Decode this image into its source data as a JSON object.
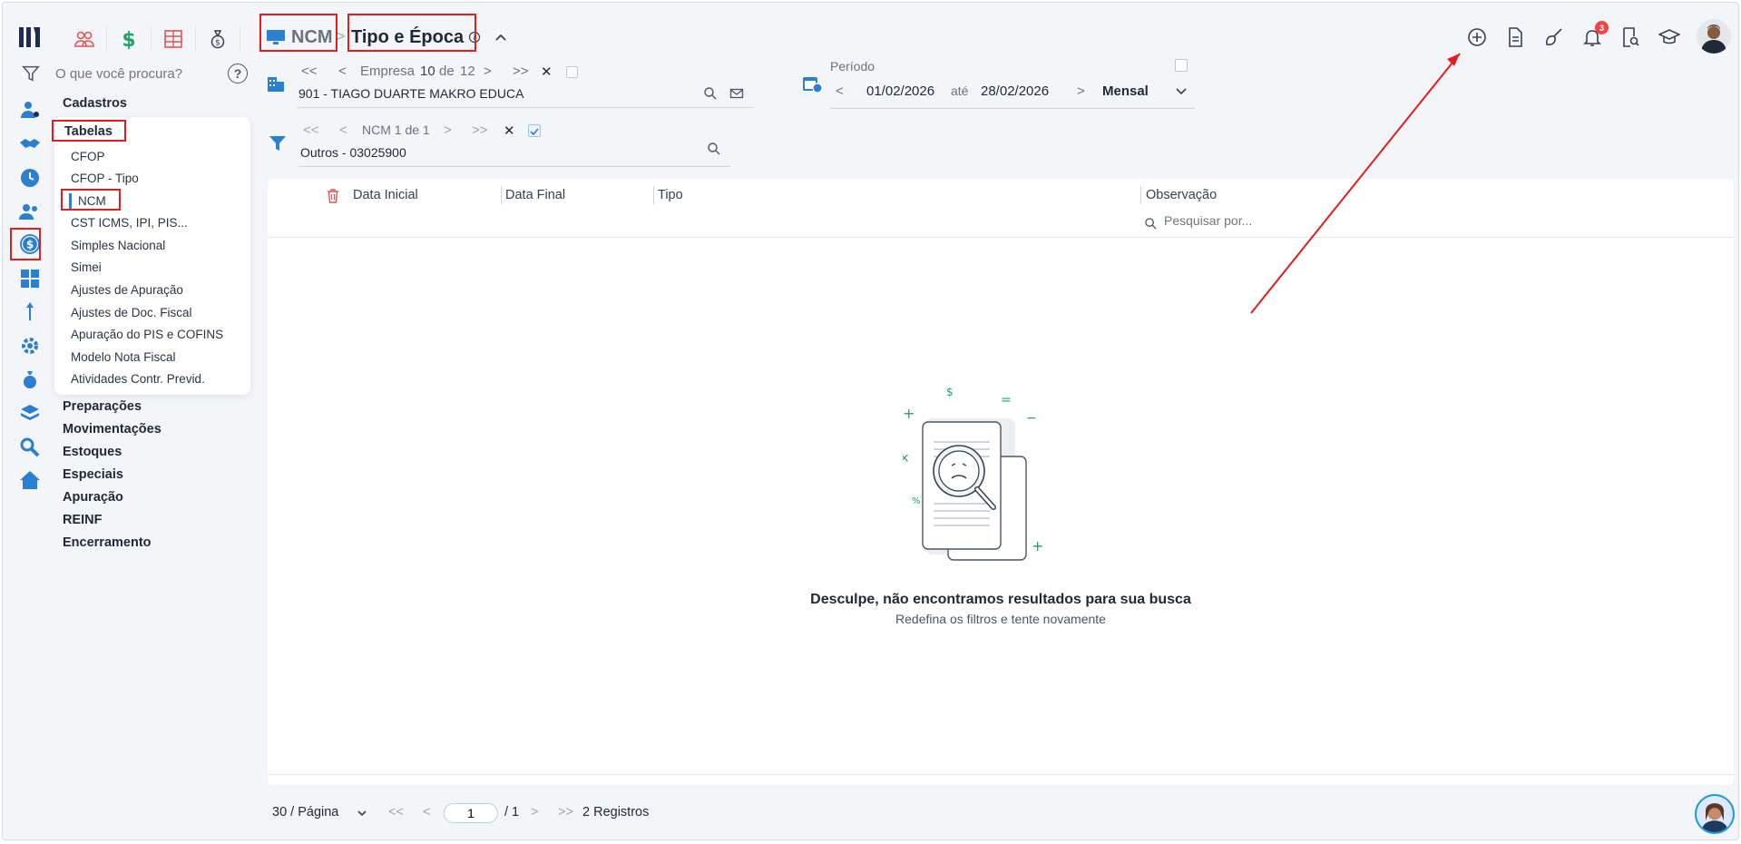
{
  "search": {
    "placeholder": "O que você procura?"
  },
  "help": {
    "label": "?"
  },
  "menu": {
    "categories_top": [
      "Cadastros"
    ],
    "tabelas_title": "Tabelas",
    "tabelas_items": [
      "CFOP",
      "CFOP - Tipo",
      "NCM",
      "CST ICMS, IPI, PIS...",
      "Simples Nacional",
      "Simei",
      "Ajustes de Apuração",
      "Ajustes de Doc. Fiscal",
      "Apuração do PIS e COFINS",
      "Modelo Nota Fiscal",
      "Atividades Contr. Previd."
    ],
    "categories_bottom": [
      "Preparações",
      "Movimentações",
      "Estoques",
      "Especiais",
      "Apuração",
      "REINF",
      "Encerramento"
    ]
  },
  "breadcrumb": {
    "module": "NCM",
    "separator": ">",
    "title": "Tipo e Época"
  },
  "empresa": {
    "first": "<<",
    "prev": "<",
    "label": "Empresa",
    "current": "10",
    "of": "de",
    "total": "12",
    "next": ">",
    "last": ">>",
    "clear": "✕",
    "value": "901 - TIAGO DUARTE MAKRO EDUCA"
  },
  "periodo": {
    "label": "Período",
    "prev": "<",
    "start": "01/02/2026",
    "ate": "até",
    "end": "28/02/2026",
    "next": ">",
    "mode": "Mensal"
  },
  "ncm": {
    "first": "<<",
    "prev": "<",
    "label": "NCM 1 de 1",
    "next": ">",
    "last": ">>",
    "clear": "✕",
    "value": "Outros - 03025900"
  },
  "table": {
    "columns": [
      "Data Inicial",
      "Data Final",
      "Tipo",
      "Observação"
    ],
    "search_placeholder": "Pesquisar por...",
    "empty_title": "Desculpe, não encontramos resultados para sua busca",
    "empty_subtitle": "Redefina os filtros e tente novamente"
  },
  "pagination": {
    "per_page": "30 / Página",
    "first": "<<",
    "prev": "<",
    "page": "1",
    "of_total": "/ 1",
    "next": ">",
    "last": ">>",
    "records": "2 Registros"
  },
  "notifications": {
    "count": "3"
  },
  "colors": {
    "accent": "#2b7fd0",
    "highlight": "#e11d1d",
    "navy": "#1e2a5a",
    "green": "#22a36a"
  }
}
